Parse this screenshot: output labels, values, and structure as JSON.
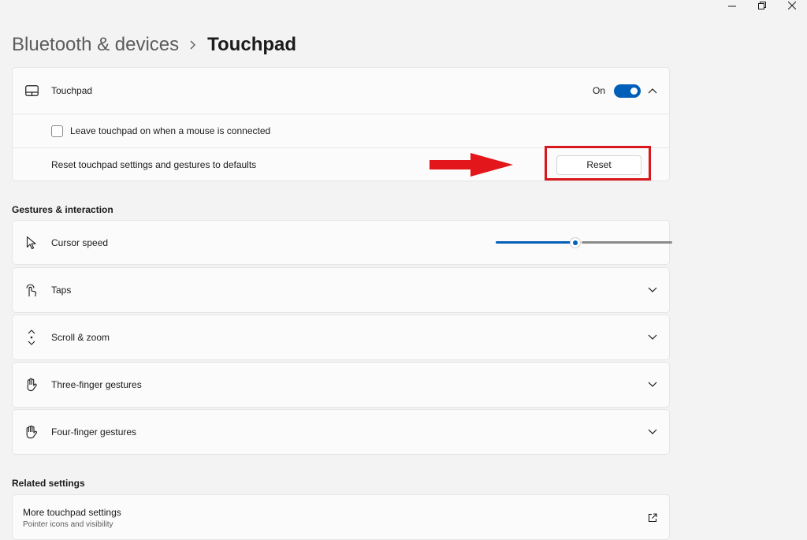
{
  "breadcrumb": {
    "parent": "Bluetooth & devices",
    "current": "Touchpad"
  },
  "touchpad_card": {
    "title": "Touchpad",
    "toggle_state": "On",
    "leave_on_label": "Leave touchpad on when a mouse is connected",
    "leave_on_checked": false,
    "reset_label": "Reset touchpad settings and gestures to defaults",
    "reset_button": "Reset"
  },
  "gestures": {
    "section_title": "Gestures & interaction",
    "cursor_speed": {
      "label": "Cursor speed",
      "value_fraction": 0.45
    },
    "items": [
      {
        "label": "Taps",
        "icon": "tap-icon"
      },
      {
        "label": "Scroll & zoom",
        "icon": "scroll-zoom-icon"
      },
      {
        "label": "Three-finger gestures",
        "icon": "three-finger-icon"
      },
      {
        "label": "Four-finger gestures",
        "icon": "four-finger-icon"
      }
    ]
  },
  "related": {
    "section_title": "Related settings",
    "more_title": "More touchpad settings",
    "more_subtitle": "Pointer icons and visibility"
  },
  "colors": {
    "accent": "#005fb8",
    "highlight": "#d9181d",
    "background": "#f3f3f3",
    "card": "#fbfbfb"
  }
}
